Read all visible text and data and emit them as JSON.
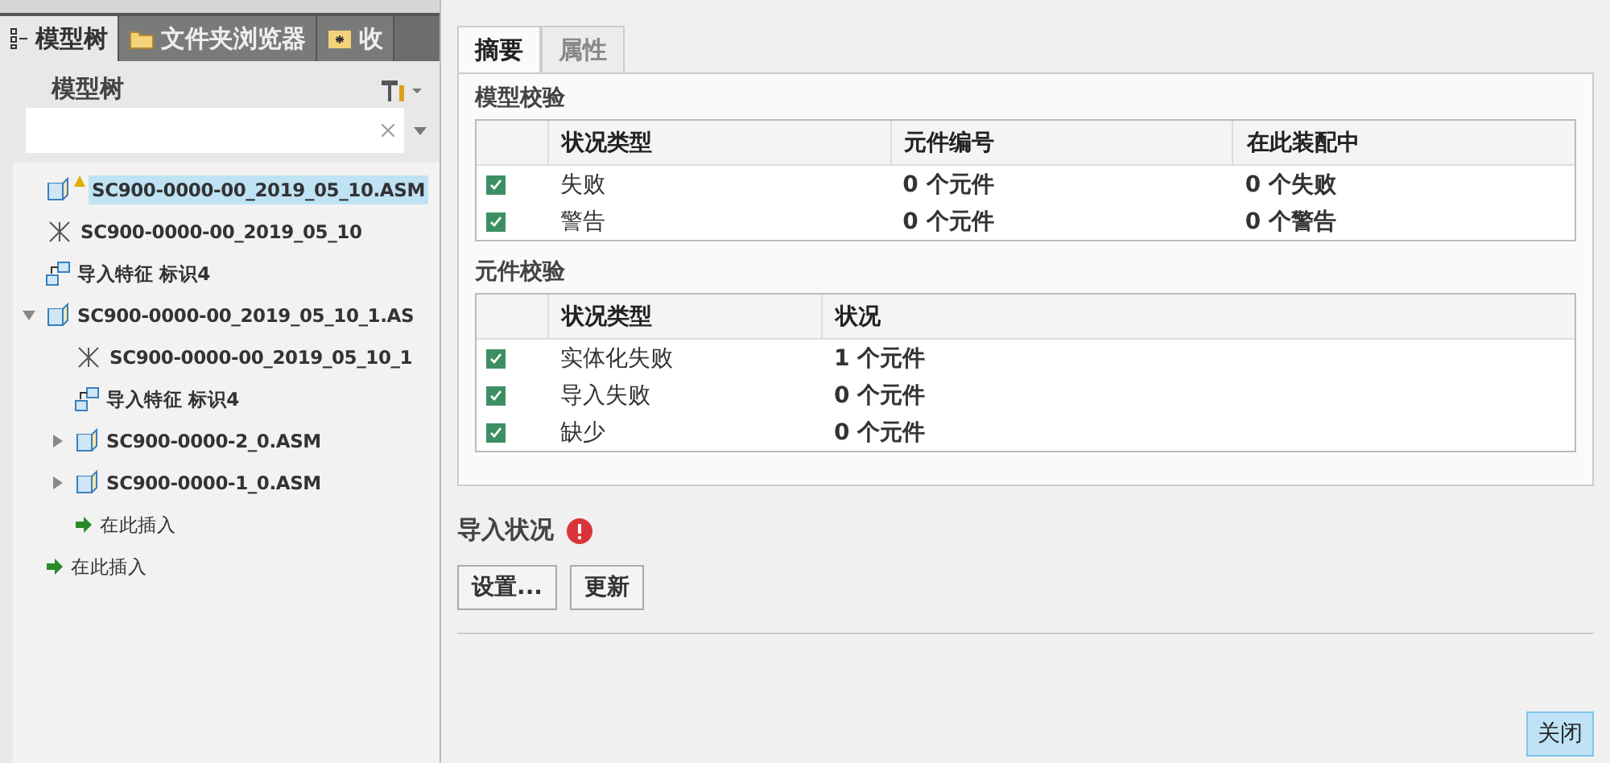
{
  "left_tabs": [
    {
      "label": "模型树",
      "kind": "tree",
      "selected": true
    },
    {
      "label": "文件夹浏览器",
      "kind": "folder",
      "selected": false
    },
    {
      "label": "收",
      "kind": "favorites",
      "selected": false
    }
  ],
  "tree_header": "模型树",
  "tree": [
    {
      "label": "SC900-0000-00_2019_05_10.ASM",
      "kind": "assembly",
      "selected": true,
      "warning": true
    },
    {
      "label": "SC900-0000-00_2019_05_10",
      "kind": "csys",
      "selected": false
    },
    {
      "label": "导入特征 标识4",
      "kind": "import",
      "selected": false
    },
    {
      "label": "SC900-0000-00_2019_05_10_1.AS",
      "kind": "assembly",
      "selected": false,
      "expanded": true,
      "children": [
        {
          "label": "SC900-0000-00_2019_05_10_1",
          "kind": "csys",
          "selected": false
        },
        {
          "label": "导入特征 标识4",
          "kind": "import",
          "selected": false
        },
        {
          "label": "SC900-0000-2_0.ASM",
          "kind": "assembly",
          "selected": false,
          "expanded": false
        },
        {
          "label": "SC900-0000-1_0.ASM",
          "kind": "assembly",
          "selected": false,
          "expanded": false
        },
        {
          "label": "在此插入",
          "kind": "insert",
          "selected": false
        }
      ]
    },
    {
      "label": "在此插入",
      "kind": "insert",
      "selected": false
    }
  ],
  "dialog_tabs": [
    {
      "label": "摘要",
      "selected": true
    },
    {
      "label": "属性",
      "selected": false
    }
  ],
  "model_check": {
    "title": "模型校验",
    "columns": [
      "状况类型",
      "元件编号",
      "在此装配中"
    ],
    "rows": [
      {
        "checked": true,
        "cells": [
          "失败",
          "0 个元件",
          "0 个失败"
        ]
      },
      {
        "checked": true,
        "cells": [
          "警告",
          "0 个元件",
          "0 个警告"
        ]
      }
    ]
  },
  "component_check": {
    "title": "元件校验",
    "columns": [
      "状况类型",
      "状况"
    ],
    "rows": [
      {
        "checked": true,
        "cells": [
          "实体化失败",
          "1 个元件"
        ]
      },
      {
        "checked": true,
        "cells": [
          "导入失败",
          "0 个元件"
        ]
      },
      {
        "checked": true,
        "cells": [
          "缺少",
          "0 个元件"
        ]
      }
    ]
  },
  "import_status": {
    "label": "导入状况",
    "error": true
  },
  "buttons": [
    "设置...",
    "更新"
  ],
  "close_button": "关闭"
}
